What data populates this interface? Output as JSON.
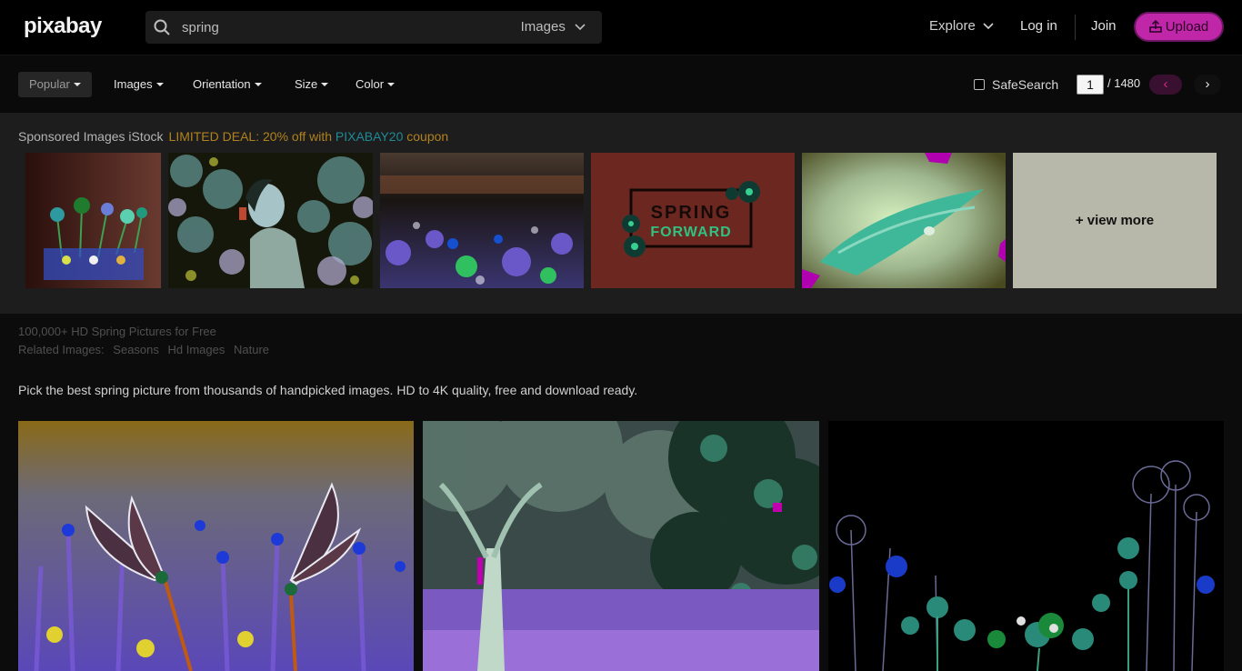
{
  "header": {
    "logo": "pixabay",
    "search_value": "spring",
    "search_type": "Images",
    "explore": "Explore",
    "login": "Log in",
    "join": "Join",
    "upload": "Upload"
  },
  "filters": {
    "items": [
      "Popular",
      "Images",
      "Orientation",
      "Size",
      "Color"
    ],
    "safesearch": "SafeSearch",
    "page": "1",
    "page_total": "/ 1480",
    "prev": "‹",
    "next": "›"
  },
  "sponsored": {
    "label": "Sponsored Images iStock",
    "deal_prefix": "LIMITED DEAL: 20% off with ",
    "deal_code": "PIXABAY20",
    "deal_suffix": " coupon",
    "view_more": "+ view more",
    "spring_forward_line1": "SPRING",
    "spring_forward_line2": "FORWARD"
  },
  "info": {
    "title": "100,000+ HD Spring Pictures for Free",
    "related_label": "Related Images:",
    "related": [
      "Seasons",
      "Hd Images",
      "Nature"
    ],
    "description": "Pick the best spring picture from thousands of handpicked images. HD to 4K quality, free and download ready."
  }
}
